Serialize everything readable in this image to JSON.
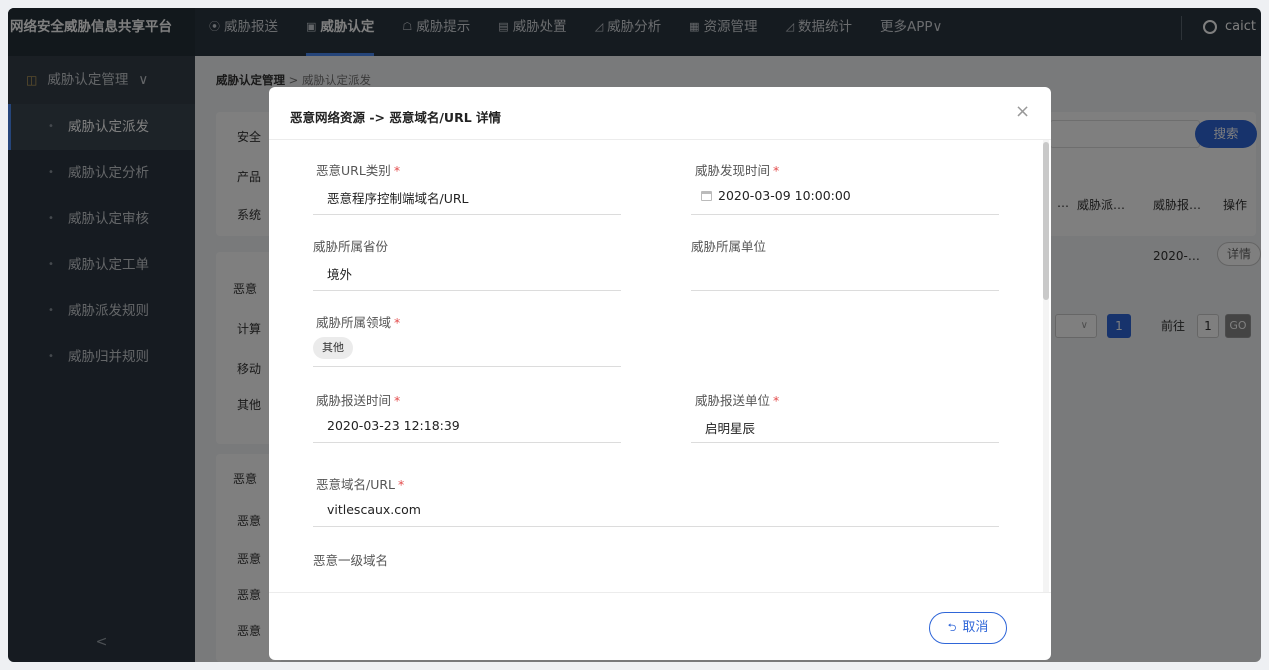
{
  "app": {
    "title": "网络安全威胁信息共享平台"
  },
  "nav": [
    {
      "icon": "⦿",
      "label": "威胁报送"
    },
    {
      "icon": "▣",
      "label": "威胁认定"
    },
    {
      "icon": "☖",
      "label": "威胁提示"
    },
    {
      "icon": "▤",
      "label": "威胁处置"
    },
    {
      "icon": "◿",
      "label": "威胁分析"
    },
    {
      "icon": "▦",
      "label": "资源管理"
    },
    {
      "icon": "◿",
      "label": "数据统计"
    },
    {
      "icon": "",
      "label": "更多APP∨"
    }
  ],
  "user": {
    "name": "caict"
  },
  "sidebar": {
    "title": "威胁认定管理",
    "items": [
      {
        "label": "威胁认定派发"
      },
      {
        "label": "威胁认定分析"
      },
      {
        "label": "威胁认定审核"
      },
      {
        "label": "威胁认定工单"
      },
      {
        "label": "威胁派发规则"
      },
      {
        "label": "威胁归并规则"
      }
    ],
    "collapse": "<"
  },
  "breadcrumb": {
    "root": "威胁认定管理",
    "sep": ">",
    "current": "威胁认定派发"
  },
  "background": {
    "filter_labels": [
      "安全",
      "产品",
      "系统"
    ],
    "group_a": {
      "title": "恶意",
      "items": [
        "计算",
        "移动",
        "其他"
      ]
    },
    "group_b": {
      "title": "恶意",
      "items": [
        "恶意",
        "恶意",
        "恶意",
        "恶意"
      ]
    },
    "search_label": "搜索",
    "table": {
      "headers": [
        "…",
        "威胁派…",
        "威胁报…",
        "操作"
      ],
      "row": {
        "date": "2020-…",
        "action": "详情"
      }
    },
    "pagination": {
      "current": "1",
      "goto_label": "前往",
      "goto_value": "1",
      "go": "GO"
    }
  },
  "modal": {
    "title": "恶意网络资源 -> 恶意域名/URL 详情",
    "close": "×",
    "fields": {
      "url_category": {
        "label": "恶意URL类别",
        "value": "恶意程序控制端域名/URL"
      },
      "discover_time": {
        "label": "威胁发现时间",
        "value": "2020-03-09 10:00:00"
      },
      "province": {
        "label": "威胁所属省份",
        "value": "境外"
      },
      "unit": {
        "label": "威胁所属单位",
        "value": ""
      },
      "domain_area": {
        "label": "威胁所属领域",
        "value": "其他"
      },
      "report_time": {
        "label": "威胁报送时间",
        "value": "2020-03-23 12:18:39"
      },
      "report_unit": {
        "label": "威胁报送单位",
        "value": "启明星辰"
      },
      "url": {
        "label": "恶意域名/URL",
        "value": "vitlescaux.com"
      },
      "top_domain": {
        "label": "恶意一级域名",
        "value": ""
      }
    },
    "required_mark": "*",
    "cancel_label": "取消",
    "cancel_icon": "⮌"
  }
}
